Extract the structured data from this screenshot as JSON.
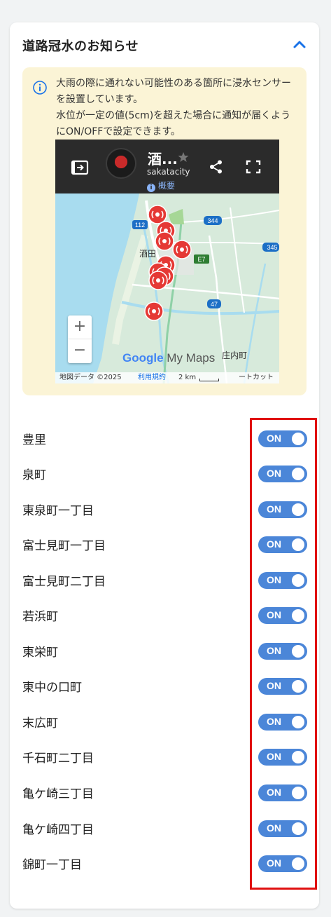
{
  "section": {
    "title": "道路冠水のお知らせ",
    "info_lines": [
      "大雨の際に通れない可能性のある箇所に浸水センサーを設置しています。",
      "水位が一定の値(5cm)を超えた場合に通知が届くようにON/OFFで設定できます。"
    ]
  },
  "map": {
    "title": "酒...",
    "user": "sakatacity",
    "about": "概要",
    "labels": {
      "city": "酒田",
      "town": "庄内町",
      "r112": "112",
      "r344": "344",
      "r345": "345",
      "r47": "47",
      "e7": "E7"
    },
    "zoom_in": "+",
    "zoom_out": "−",
    "logo_google": "Google",
    "logo_maps": "My Maps",
    "footer": {
      "data": "地図データ ©2025",
      "terms": "利用規約",
      "scale": "2 km",
      "shortcut": "ートカット"
    }
  },
  "toggles": [
    {
      "label": "豊里",
      "state": "ON"
    },
    {
      "label": "泉町",
      "state": "ON"
    },
    {
      "label": "東泉町一丁目",
      "state": "ON"
    },
    {
      "label": "富士見町一丁目",
      "state": "ON"
    },
    {
      "label": "富士見町二丁目",
      "state": "ON"
    },
    {
      "label": "若浜町",
      "state": "ON"
    },
    {
      "label": "東栄町",
      "state": "ON"
    },
    {
      "label": "東中の口町",
      "state": "ON"
    },
    {
      "label": "末広町",
      "state": "ON"
    },
    {
      "label": "千石町二丁目",
      "state": "ON"
    },
    {
      "label": "亀ケ崎三丁目",
      "state": "ON"
    },
    {
      "label": "亀ケ崎四丁目",
      "state": "ON"
    },
    {
      "label": "錦町一丁目",
      "state": "ON"
    }
  ],
  "colors": {
    "toggle_on": "#4b86d8",
    "info_bg": "#fbf4d6",
    "highlight": "#e01010",
    "accent": "#1a73e8"
  }
}
